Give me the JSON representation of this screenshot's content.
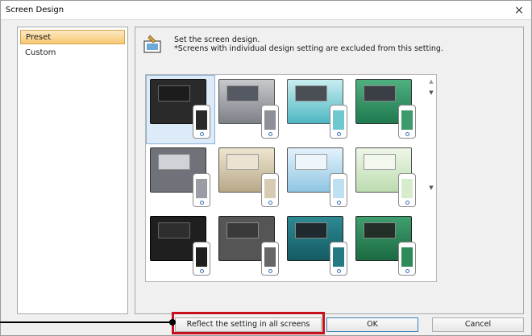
{
  "window": {
    "title": "Screen Design",
    "close_glyph": "×"
  },
  "nav": {
    "items": [
      {
        "label": "Preset",
        "selected": true
      },
      {
        "label": "Custom",
        "selected": false
      }
    ]
  },
  "panel": {
    "line1": "Set the screen design.",
    "line2": "*Screens with individual design setting are excluded from this setting."
  },
  "scroll": {
    "up": "▲",
    "down": "▼"
  },
  "buttons": {
    "reflect": "Reflect the setting in all screens",
    "ok": "OK",
    "cancel": "Cancel"
  },
  "colors": {
    "highlight": "#c8101c",
    "selection": "#dcebf7"
  }
}
